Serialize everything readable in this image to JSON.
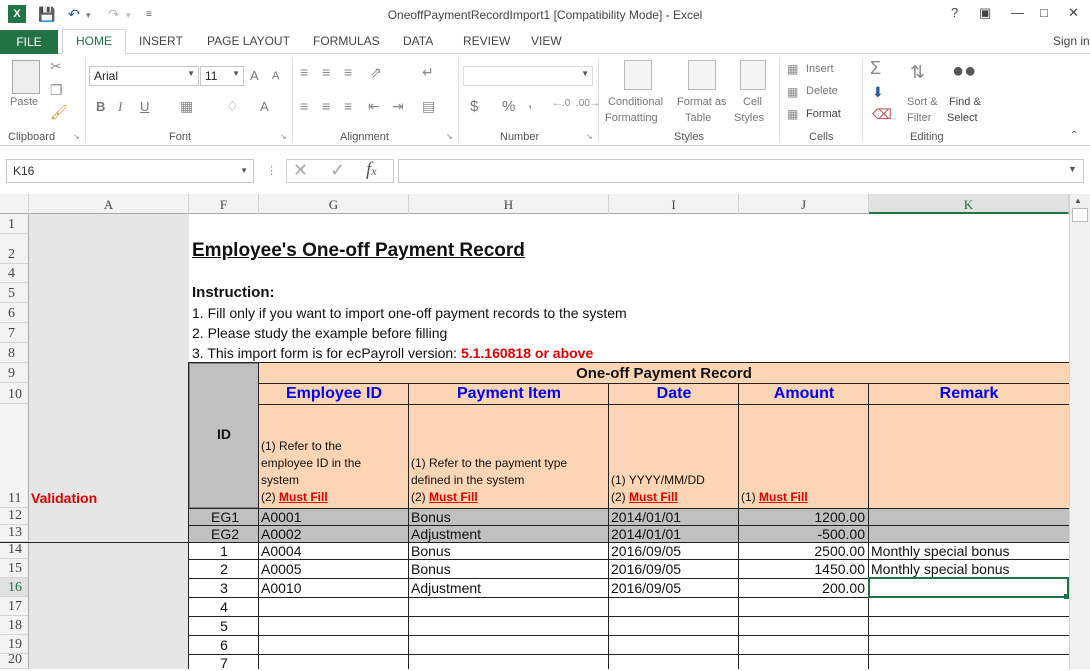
{
  "window": {
    "title": "OneoffPaymentRecordImport1  [Compatibility Mode] - Excel",
    "help": "?",
    "sign_in": "Sign in"
  },
  "tabs": [
    "FILE",
    "HOME",
    "INSERT",
    "PAGE LAYOUT",
    "FORMULAS",
    "DATA",
    "REVIEW",
    "VIEW"
  ],
  "ribbon": {
    "groups": [
      "Clipboard",
      "Font",
      "Alignment",
      "Number",
      "Styles",
      "Cells",
      "Editing"
    ],
    "paste": "Paste",
    "font_name": "Arial",
    "font_size": "11",
    "bold": "B",
    "italic": "I",
    "underline": "U",
    "grow_font": "A",
    "shrink_font": "A",
    "font_color": "A",
    "currency": "$",
    "percent": "%",
    "comma": ",",
    "cond_format_1": "Conditional",
    "cond_format_2": "Formatting",
    "format_table_1": "Format as",
    "format_table_2": "Table",
    "cell_styles_1": "Cell",
    "cell_styles_2": "Styles",
    "insert": "Insert",
    "delete": "Delete",
    "format": "Format",
    "sort_1": "Sort &",
    "sort_2": "Filter",
    "find_1": "Find &",
    "find_2": "Select"
  },
  "formula_bar": {
    "name_box": "K16",
    "formula": ""
  },
  "columns": [
    {
      "label": "A",
      "selected": false
    },
    {
      "label": "F",
      "selected": false
    },
    {
      "label": "G",
      "selected": false
    },
    {
      "label": "H",
      "selected": false
    },
    {
      "label": "I",
      "selected": false
    },
    {
      "label": "J",
      "selected": false
    },
    {
      "label": "K",
      "selected": true
    }
  ],
  "rows": [
    "1",
    "2",
    "4",
    "5",
    "6",
    "7",
    "8",
    "9",
    "10",
    "11",
    "12",
    "13",
    "14",
    "15",
    "16",
    "17",
    "18",
    "19",
    "20"
  ],
  "selected_row": "16",
  "sheet": {
    "heading": "Employee's One-off Payment Record",
    "instruction_title": "Instruction:",
    "instruction_1": "1. Fill only if you want to import one-off payment records to the system",
    "instruction_2": "2. Please study the example before filling",
    "instruction_3_prefix": "3. This import form is for ecPayroll version: ",
    "instruction_3_version": "5.1.160818 or above",
    "validation_label": "Validation",
    "group_header": "One-off Payment Record",
    "id_header": "ID",
    "headers": [
      "Employee ID",
      "Payment Item",
      "Date",
      "Amount",
      "Remark"
    ],
    "must_fill": "Must Fill",
    "validation_emp_1": "(1) Refer to the",
    "validation_emp_2": "employee ID in the",
    "validation_emp_3": "system",
    "validation_emp_4": "(2) ",
    "validation_pay_1": "(1) Refer to the payment type",
    "validation_pay_2": "defined in the system",
    "validation_pay_3": "(2) ",
    "validation_date_1": "(1) YYYY/MM/DD",
    "validation_date_2": "(2) ",
    "validation_amt_1": "(1) ",
    "examples": [
      {
        "id": "EG1",
        "emp": "A0001",
        "item": "Bonus",
        "date": "2014/01/01",
        "amount": "1200.00",
        "remark": ""
      },
      {
        "id": "EG2",
        "emp": "A0002",
        "item": "Adjustment",
        "date": "2014/01/01",
        "amount": "-500.00",
        "remark": ""
      }
    ],
    "records": [
      {
        "id": "1",
        "emp": "A0004",
        "item": "Bonus",
        "date": "2016/09/05",
        "amount": "2500.00",
        "remark": "Monthly special bonus"
      },
      {
        "id": "2",
        "emp": "A0005",
        "item": "Bonus",
        "date": "2016/09/05",
        "amount": "1450.00",
        "remark": "Monthly special bonus"
      },
      {
        "id": "3",
        "emp": "A0010",
        "item": "Adjustment",
        "date": "2016/09/05",
        "amount": "200.00",
        "remark": ""
      }
    ],
    "empty_ids": [
      "4",
      "5",
      "6",
      "7"
    ]
  },
  "colors": {
    "excel_green": "#217346",
    "header_fill": "#fcd5b4",
    "id_fill": "#c0c0c0",
    "example_fill": "#c0c0c0",
    "sidebar_fill": "#e6e6e6",
    "header_text": "#0000ff",
    "validation_text": "#e00000"
  }
}
